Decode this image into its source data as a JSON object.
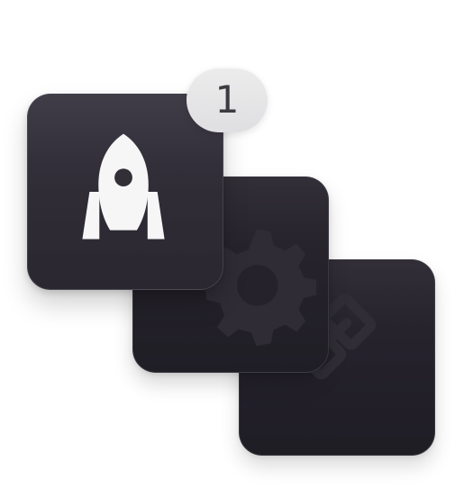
{
  "app_stack": {
    "badge": {
      "count": "1"
    },
    "cards": [
      {
        "icon": "rocket-icon"
      },
      {
        "icon": "gear-icon"
      },
      {
        "icon": "link-icon"
      }
    ]
  },
  "colors": {
    "page_background": "#ffffff",
    "card_primary": "#322f37",
    "card_secondary": "#25232b",
    "card_tertiary": "#23212a",
    "badge_background": "#e5e5e7",
    "badge_text": "#3b3b40",
    "icon_primary": "#f6f6f7",
    "icon_secondary": "#2f2c35",
    "icon_tertiary": "#302d36"
  }
}
